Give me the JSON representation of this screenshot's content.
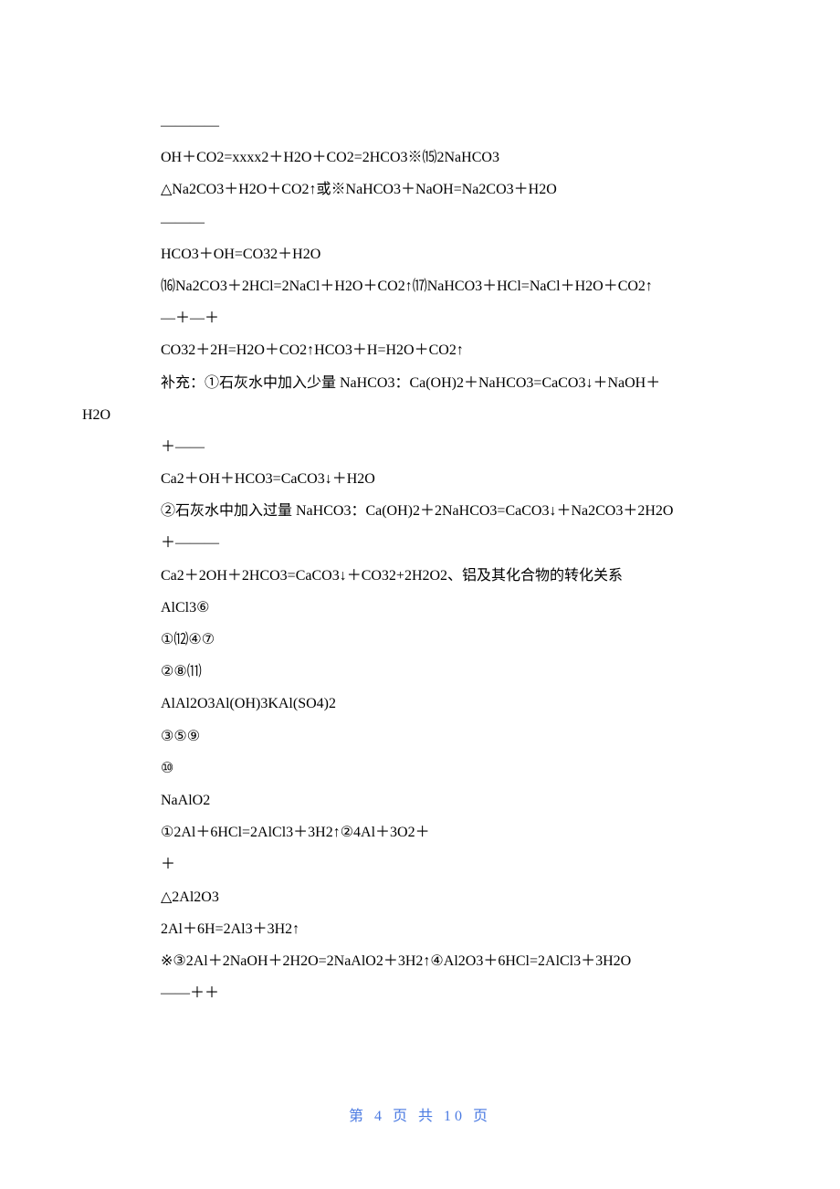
{
  "lines": [
    "————",
    "OH＋CO2=xxxx2＋H2O＋CO2=2HCO3※⒂2NaHCO3",
    "△Na2CO3＋H2O＋CO2↑或※NaHCO3＋NaOH=Na2CO3＋H2O",
    "———",
    "HCO3＋OH=CO32＋H2O",
    "⒃Na2CO3＋2HCl=2NaCl＋H2O＋CO2↑⒄NaHCO3＋HCl=NaCl＋H2O＋CO2↑",
    "—＋—＋",
    "CO32＋2H=H2O＋CO2↑HCO3＋H=H2O＋CO2↑",
    "补充：①石灰水中加入少量 NaHCO3：Ca(OH)2＋NaHCO3=CaCO3↓＋NaOH＋",
    "＋——",
    "Ca2＋OH＋HCO3=CaCO3↓＋H2O",
    "②石灰水中加入过量 NaHCO3：Ca(OH)2＋2NaHCO3=CaCO3↓＋Na2CO3＋2H2O",
    "＋———",
    "Ca2＋2OH＋2HCO3=CaCO3↓＋CO32+2H2O2、铝及其化合物的转化关系",
    "AlCl3⑥",
    "①⑿④⑦",
    "②⑧⑾",
    "AlAl2O3Al(OH)3KAl(SO4)2",
    "③⑤⑨",
    "⑩",
    "NaAlO2",
    "①2Al＋6HCl=2AlCl3＋3H2↑②4Al＋3O2＋",
    "＋",
    "△2Al2O3",
    "2Al＋6H=2Al3＋3H2↑",
    "※③2Al＋2NaOH＋2H2O=2NaAlO2＋3H2↑④Al2O3＋6HCl=2AlCl3＋3H2O",
    "——＋＋"
  ],
  "h2o_line": "H2O",
  "footer": "第 4 页 共 10 页"
}
